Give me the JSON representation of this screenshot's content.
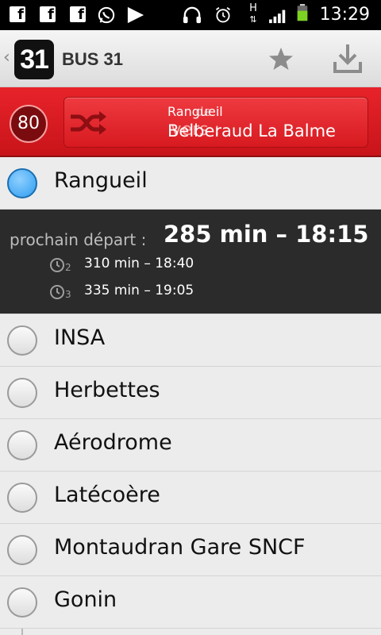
{
  "status_bar": {
    "time": "13:29",
    "icons": [
      "facebook-icon",
      "facebook-icon",
      "facebook-icon",
      "whatsapp-icon",
      "play-store-icon",
      "headphones-icon",
      "alarm-icon",
      "hspa-icon",
      "signal-icon",
      "battery-icon"
    ],
    "network_label": "H"
  },
  "action_bar": {
    "back_glyph": "‹",
    "line_number": "31",
    "title": "BUS 31",
    "favorite_icon": "star-icon",
    "download_icon": "download-icon"
  },
  "direction": {
    "route_number": "80",
    "swap_icon": "shuffle-icon",
    "from_label": "de :",
    "from_stop": "Rangueil",
    "to_label": "vers :",
    "to_stop": "Belberaud La Balme",
    "accent_color": "#d71a20"
  },
  "current_stop": {
    "name": "Rangueil",
    "active_color": "#2e9cf0"
  },
  "departures": {
    "next_label": "prochain départ :",
    "next": "285 min – 18:15",
    "alternatives": [
      {
        "index": "2",
        "text": "310 min – 18:40"
      },
      {
        "index": "3",
        "text": "335 min – 19:05"
      }
    ]
  },
  "stops": [
    {
      "name": "INSA"
    },
    {
      "name": "Herbettes"
    },
    {
      "name": "Aérodrome"
    },
    {
      "name": "Latécoère"
    },
    {
      "name": "Montaudran Gare SNCF"
    },
    {
      "name": "Gonin"
    }
  ]
}
